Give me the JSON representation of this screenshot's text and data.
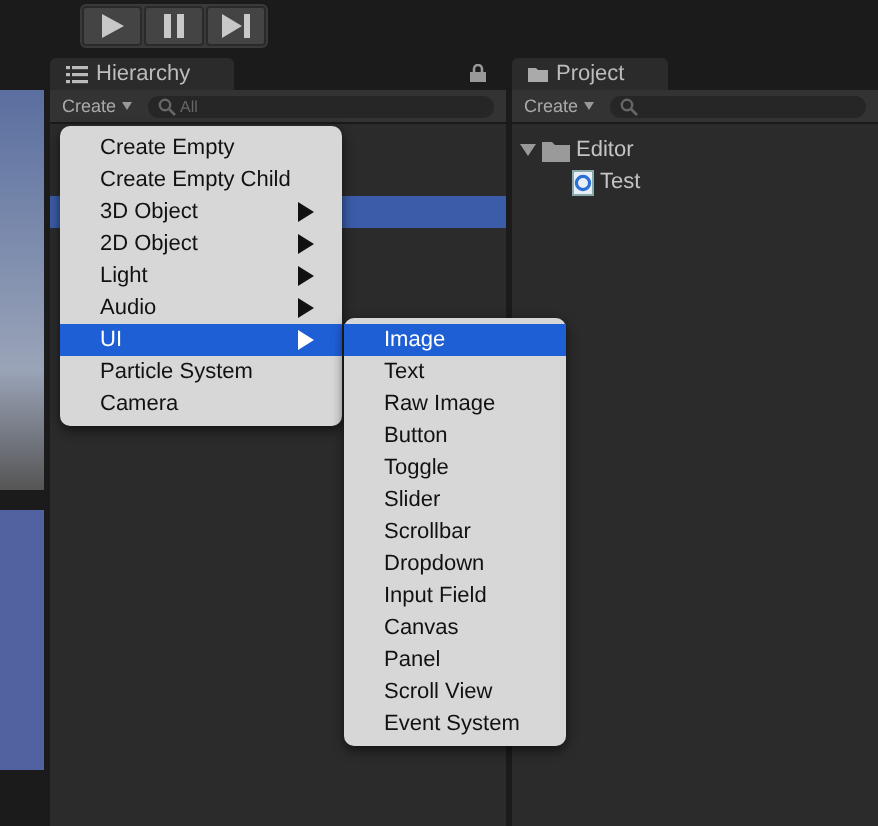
{
  "hierarchy": {
    "title": "Hierarchy",
    "create": "Create",
    "search_placeholder": "All"
  },
  "project": {
    "title": "Project",
    "create": "Create",
    "tree": [
      {
        "label": "Editor",
        "kind": "folder",
        "expanded": true,
        "children": [
          {
            "label": "Test",
            "kind": "script"
          }
        ]
      }
    ]
  },
  "menu": [
    {
      "label": "Create Empty",
      "submenu": false,
      "selected": false
    },
    {
      "label": "Create Empty Child",
      "submenu": false,
      "selected": false
    },
    {
      "label": "3D Object",
      "submenu": true,
      "selected": false
    },
    {
      "label": "2D Object",
      "submenu": true,
      "selected": false
    },
    {
      "label": "Light",
      "submenu": true,
      "selected": false
    },
    {
      "label": "Audio",
      "submenu": true,
      "selected": false
    },
    {
      "label": "UI",
      "submenu": true,
      "selected": true
    },
    {
      "label": "Particle System",
      "submenu": false,
      "selected": false
    },
    {
      "label": "Camera",
      "submenu": false,
      "selected": false
    }
  ],
  "submenu": [
    {
      "label": "Image",
      "selected": true
    },
    {
      "label": "Text",
      "selected": false
    },
    {
      "label": "Raw Image",
      "selected": false
    },
    {
      "label": "Button",
      "selected": false
    },
    {
      "label": "Toggle",
      "selected": false
    },
    {
      "label": "Slider",
      "selected": false
    },
    {
      "label": "Scrollbar",
      "selected": false
    },
    {
      "label": "Dropdown",
      "selected": false
    },
    {
      "label": "Input Field",
      "selected": false
    },
    {
      "label": "Canvas",
      "selected": false
    },
    {
      "label": "Panel",
      "selected": false
    },
    {
      "label": "Scroll View",
      "selected": false
    },
    {
      "label": "Event System",
      "selected": false
    }
  ]
}
